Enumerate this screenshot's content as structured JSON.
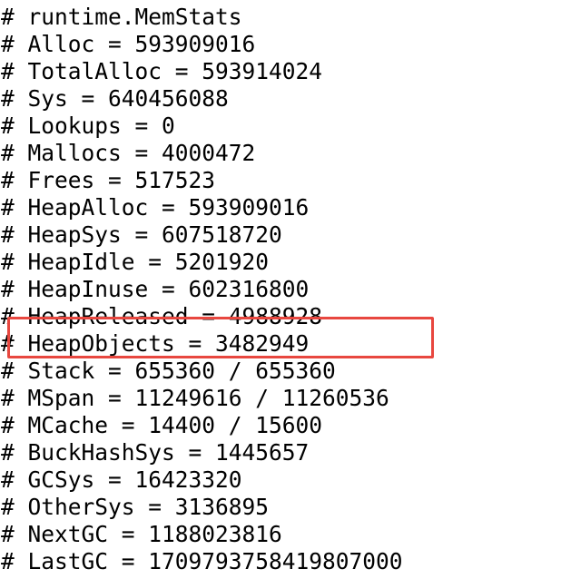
{
  "colors": {
    "background": "#ffffff",
    "text": "#000000",
    "highlight": "#e8473f"
  },
  "highlight": {
    "target_line": "HeapObjects"
  },
  "lines": [
    "# runtime.MemStats",
    "# Alloc = 593909016",
    "# TotalAlloc = 593914024",
    "# Sys = 640456088",
    "# Lookups = 0",
    "# Mallocs = 4000472",
    "# Frees = 517523",
    "# HeapAlloc = 593909016",
    "# HeapSys = 607518720",
    "# HeapIdle = 5201920",
    "# HeapInuse = 602316800",
    "# HeapReleased = 4988928",
    "# HeapObjects = 3482949",
    "# Stack = 655360 / 655360",
    "# MSpan = 11249616 / 11260536",
    "# MCache = 14400 / 15600",
    "# BuckHashSys = 1445657",
    "# GCSys = 16423320",
    "# OtherSys = 3136895",
    "# NextGC = 1188023816",
    "# LastGC = 1709793758419807000"
  ]
}
